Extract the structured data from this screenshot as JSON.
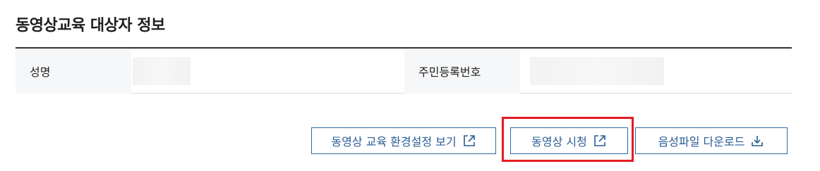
{
  "section": {
    "title": "동영상교육 대상자 정보"
  },
  "info_table": {
    "name_label": "성명",
    "rrn_label": "주민등록번호"
  },
  "buttons": {
    "env_settings_label": "동영상 교육 환경설정 보기",
    "watch_video_label": "동영상 시청",
    "audio_download_label": "음성파일 다운로드",
    "env_settings_icon": "external-link-icon",
    "watch_video_icon": "external-link-icon",
    "audio_download_icon": "download-icon"
  },
  "colors": {
    "button_border": "#2f6aa8",
    "button_text": "#2a5c95",
    "highlight": "#e41b23",
    "label_bg": "#f6f7f9"
  }
}
